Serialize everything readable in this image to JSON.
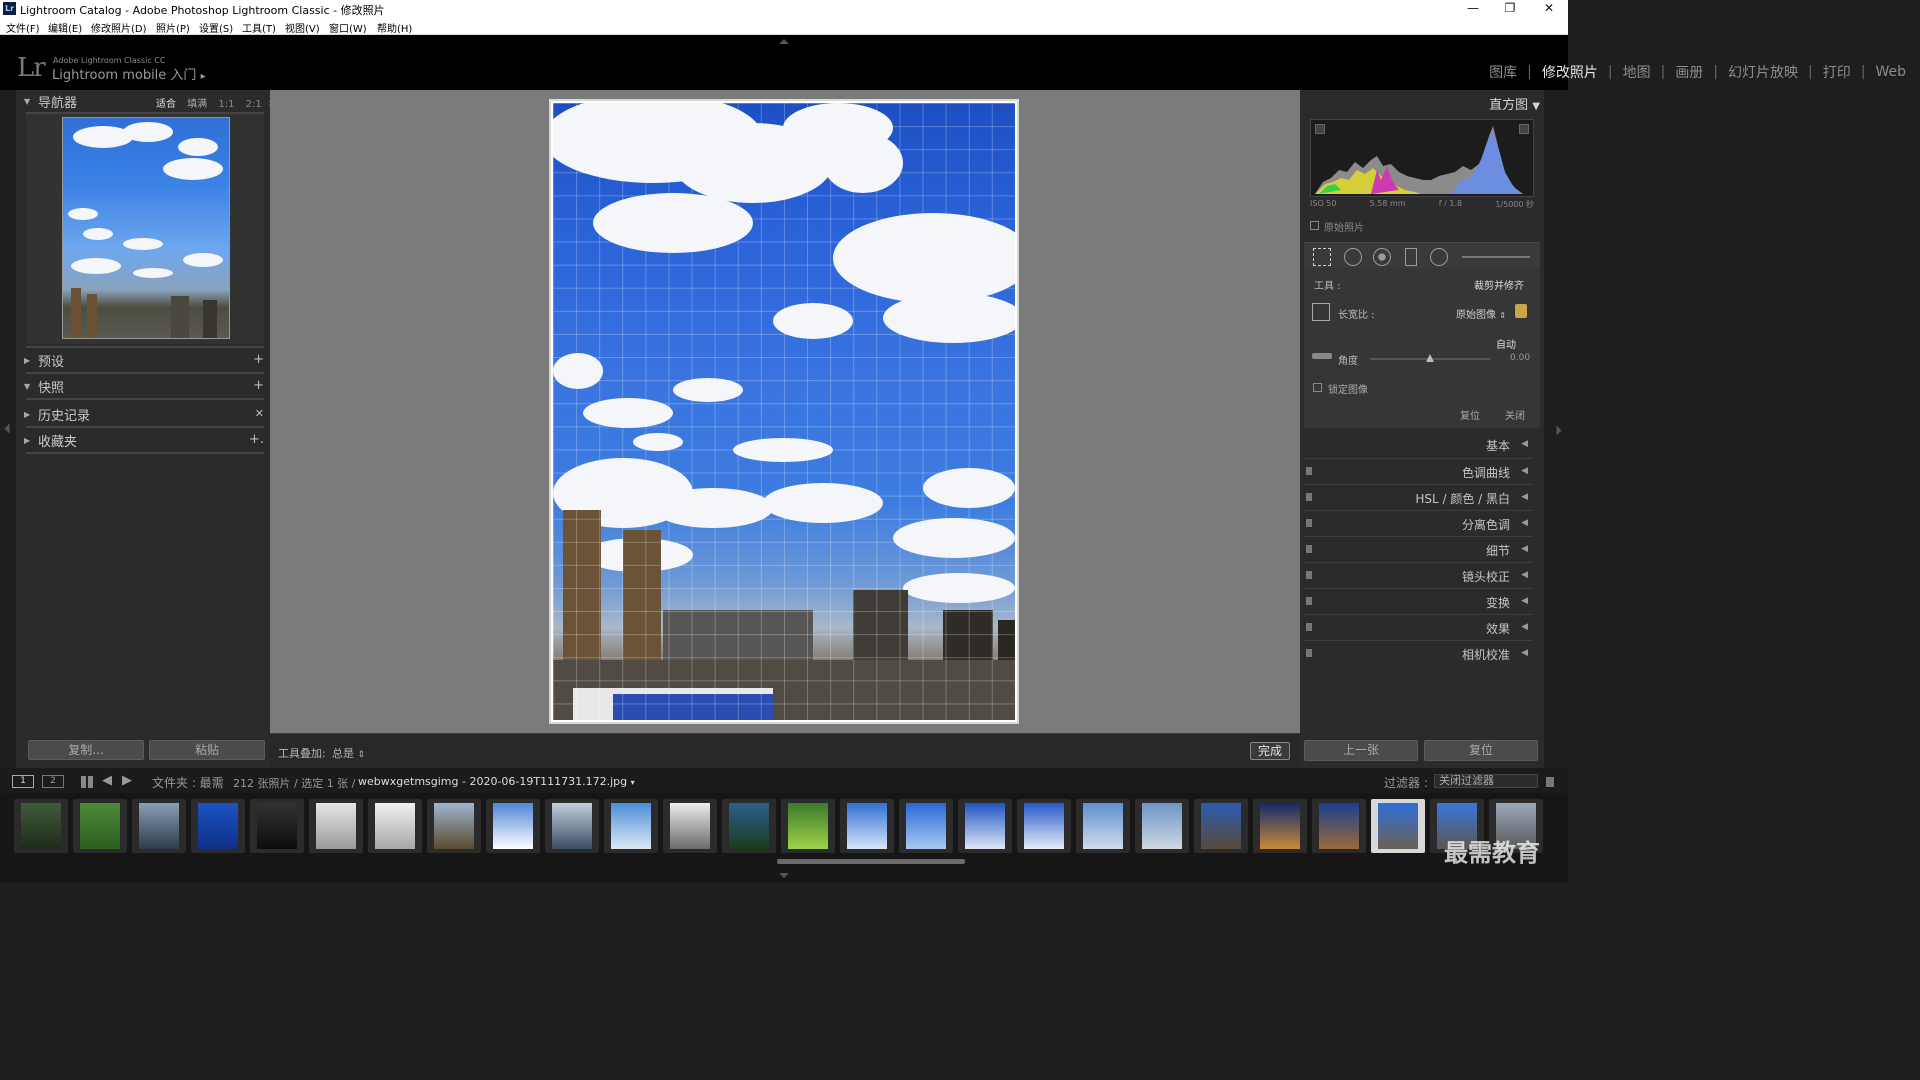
{
  "window": {
    "title": "Lightroom Catalog - Adobe Photoshop Lightroom Classic - 修改照片",
    "logo_text": "Lr",
    "minimize": "—",
    "maximize": "❐",
    "close": "✕"
  },
  "menubar": [
    "文件(F)",
    "编辑(E)",
    "修改照片(D)",
    "照片(P)",
    "设置(S)",
    "工具(T)",
    "视图(V)",
    "窗口(W)",
    "帮助(H)"
  ],
  "identity": {
    "logo": "Lr",
    "small": "Adobe Lightroom Classic CC",
    "big": "Lightroom mobile 入门",
    "arrow": "▸"
  },
  "modules": [
    {
      "label": "图库",
      "active": false
    },
    {
      "label": "修改照片",
      "active": true
    },
    {
      "label": "地图",
      "active": false
    },
    {
      "label": "画册",
      "active": false
    },
    {
      "label": "幻灯片放映",
      "active": false
    },
    {
      "label": "打印",
      "active": false
    },
    {
      "label": "Web",
      "active": false
    }
  ],
  "left_panel": {
    "navigator": {
      "title": "导航器",
      "zoom_options": [
        "适合",
        "填满",
        "1:1",
        "2:1"
      ],
      "zoom_selected": "适合"
    },
    "sections": [
      {
        "label": "预设",
        "expanded": false,
        "action": "+"
      },
      {
        "label": "快照",
        "expanded": true,
        "action": "+"
      },
      {
        "label": "历史记录",
        "expanded": false,
        "action": "✕"
      },
      {
        "label": "收藏夹",
        "expanded": false,
        "action": "+."
      }
    ],
    "copy_button": "复制...",
    "paste_button": "粘贴"
  },
  "toolbar": {
    "overlay_label": "工具叠加:",
    "overlay_value": "总是",
    "done_button": "完成"
  },
  "right_panel": {
    "histogram_title": "直方图",
    "exif": [
      "ISO 50",
      "5.58 mm",
      "f / 1.8",
      "1/5000 秒"
    ],
    "original_photo": "原始照片",
    "tool_label": "工具 :",
    "tool_name": "裁剪并修齐",
    "aspect_label": "长宽比 :",
    "aspect_value": "原始图像",
    "auto_label": "自动",
    "angle_label": "角度",
    "angle_value": "0.00",
    "angle_slider": 0.5,
    "lock_image": "锁定图像",
    "reset_label": "复位",
    "close_label": "关闭",
    "sections": [
      "基本",
      "色调曲线",
      "HSL / 颜色 / 黑白",
      "分离色调",
      "细节",
      "镜头校正",
      "变换",
      "效果",
      "相机校准"
    ],
    "prev_button": "上一张",
    "reset_button": "复位"
  },
  "filmstrip_bar": {
    "view1": "1",
    "view2": "2",
    "source_label": "文件夹 : 最需",
    "count": "212 张照片 / 选定 1 张 /",
    "filename": "webwxgetmsgimg - 2020-06-19T111731.172.jpg",
    "filter_label": "过滤器 :",
    "filter_value": "关闭过滤器"
  },
  "filmstrip": {
    "selected_index": 23,
    "thumbs": [
      {
        "colors": [
          "#3e5c3a",
          "#1f2a1a"
        ]
      },
      {
        "colors": [
          "#4d8a35",
          "#2c5e20"
        ]
      },
      {
        "colors": [
          "#8a9fb5",
          "#2e3b4a"
        ]
      },
      {
        "colors": [
          "#1b53c4",
          "#0e2f86"
        ]
      },
      {
        "colors": [
          "#333333",
          "#0c0c0c"
        ]
      },
      {
        "colors": [
          "#e6e6e6",
          "#9a9a9a"
        ]
      },
      {
        "colors": [
          "#f0f0f0",
          "#a7a7a7"
        ]
      },
      {
        "colors": [
          "#9fb6cf",
          "#5a4a30"
        ]
      },
      {
        "colors": [
          "#4e86d6",
          "#ffffff"
        ]
      },
      {
        "colors": [
          "#c4cfdc",
          "#394b63"
        ]
      },
      {
        "colors": [
          "#4a8ed8",
          "#dde9f5"
        ]
      },
      {
        "colors": [
          "#ececec",
          "#6b6b6b"
        ]
      },
      {
        "colors": [
          "#2d5f8c",
          "#1a3c1a"
        ]
      },
      {
        "colors": [
          "#3b7a2a",
          "#9fd24a"
        ]
      },
      {
        "colors": [
          "#3170d4",
          "#d6e4f5"
        ]
      },
      {
        "colors": [
          "#2a68d6",
          "#a9c9f1"
        ]
      },
      {
        "colors": [
          "#1f54c0",
          "#dde7f6"
        ]
      },
      {
        "colors": [
          "#2658c8",
          "#e5edf8"
        ]
      },
      {
        "colors": [
          "#5f8fd0",
          "#d1dcea"
        ]
      },
      {
        "colors": [
          "#6d95c8",
          "#cfd8e2"
        ]
      },
      {
        "colors": [
          "#2a5cb0",
          "#5a4a3a"
        ]
      },
      {
        "colors": [
          "#132a6a",
          "#c78a3a"
        ]
      },
      {
        "colors": [
          "#1a3f8f",
          "#9a6a3a"
        ]
      },
      {
        "colors": [
          "#2f6fd6",
          "#6b6155"
        ]
      },
      {
        "colors": [
          "#3a78d8",
          "#5a5550"
        ]
      },
      {
        "colors": [
          "#9aa8b8",
          "#5a5a5a"
        ]
      }
    ]
  },
  "watermark": "最需教育"
}
